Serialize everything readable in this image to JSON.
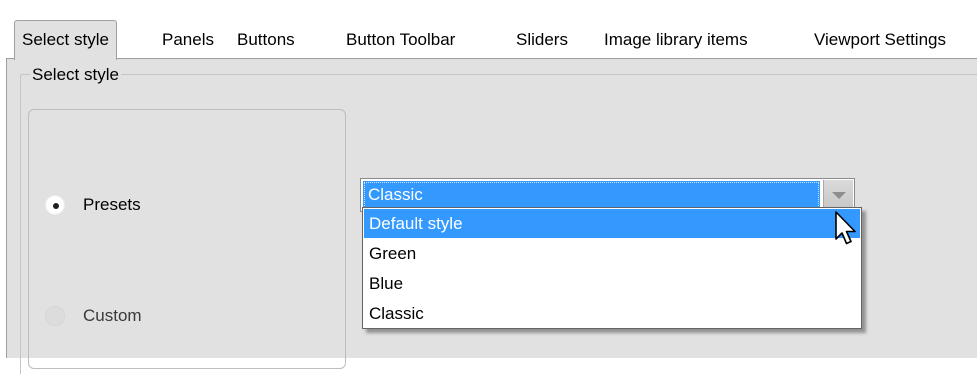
{
  "tabs": [
    {
      "label": "Select style",
      "active": true
    },
    {
      "label": "Panels",
      "active": false
    },
    {
      "label": "Buttons",
      "active": false
    },
    {
      "label": "Button Toolbar",
      "active": false
    },
    {
      "label": "Sliders",
      "active": false
    },
    {
      "label": "Image library items",
      "active": false
    },
    {
      "label": "Viewport Settings",
      "active": false
    }
  ],
  "group": {
    "legend": "Select style"
  },
  "radios": {
    "presets": {
      "label": "Presets",
      "checked": true
    },
    "custom": {
      "label": "Custom",
      "checked": false
    }
  },
  "combo": {
    "selected_value": "Classic",
    "arrow_icon": "chevron-down-icon"
  },
  "dropdown": {
    "options": [
      "Default style",
      "Green",
      "Blue",
      "Classic"
    ],
    "highlighted_index": 0
  },
  "cursor": {
    "icon": "arrow-pointer-icon"
  },
  "colors": {
    "selection": "#3399ff",
    "panel_background": "#e1e1e1",
    "border": "#a0a0a0"
  }
}
